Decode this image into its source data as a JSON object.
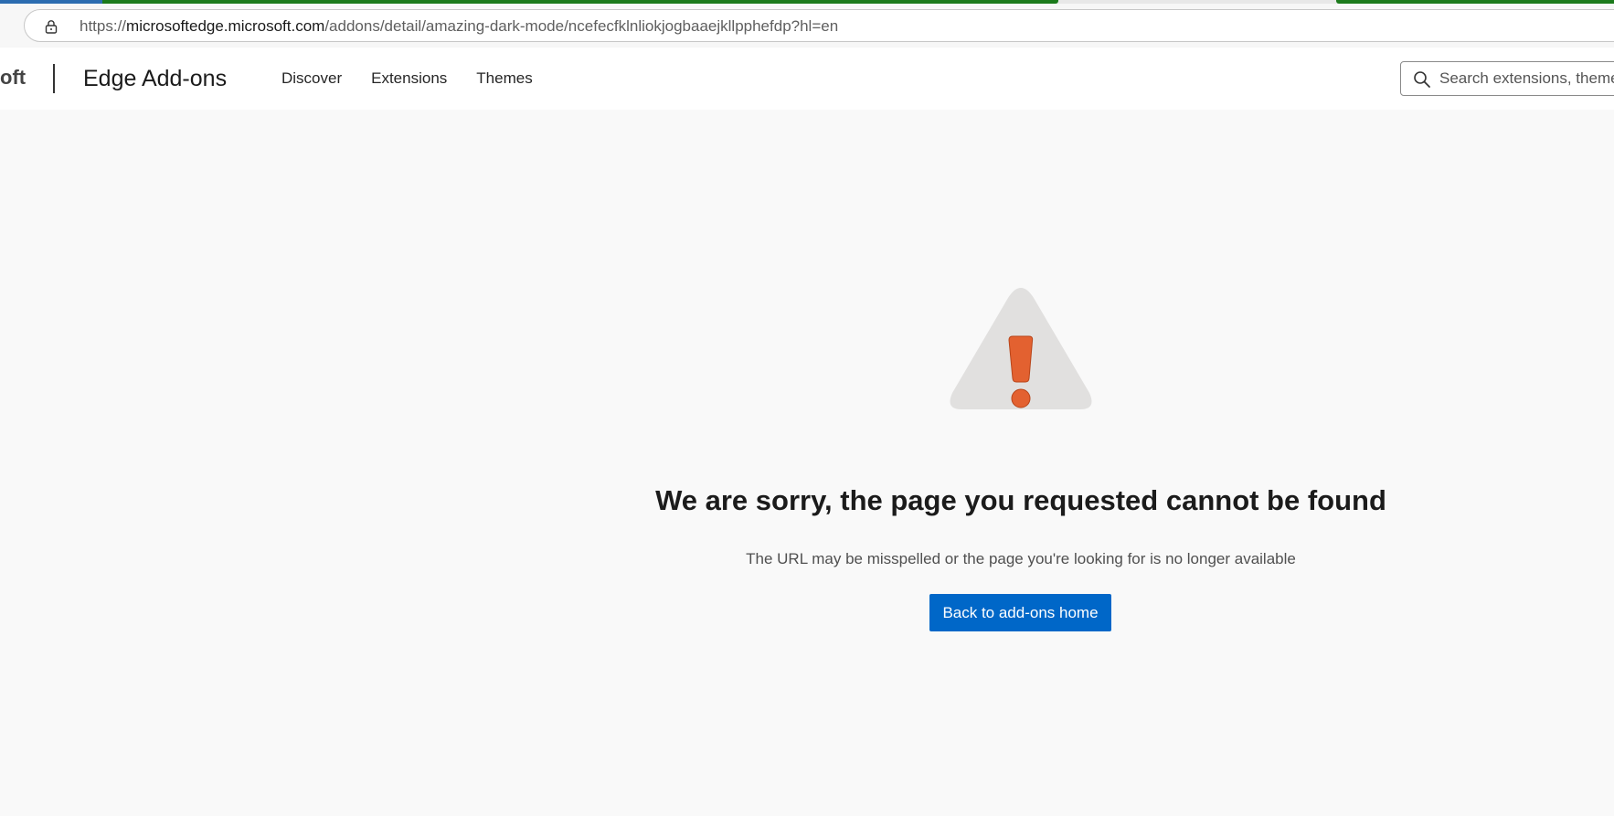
{
  "browser": {
    "url_scheme": "https://",
    "url_host": "microsoftedge.microsoft.com",
    "url_path": "/addons/detail/amazing-dark-mode/ncefecfklnliokjogbaaejkllpphefdp?hl=en"
  },
  "header": {
    "brand_fragment": "oft",
    "product_title": "Edge Add-ons",
    "nav": [
      {
        "label": "Discover"
      },
      {
        "label": "Extensions"
      },
      {
        "label": "Themes"
      }
    ],
    "search": {
      "placeholder": "Search extensions, themes"
    }
  },
  "error": {
    "title": "We are sorry, the page you requested cannot be found",
    "subtitle": "The URL may be misspelled or the page you're looking for is no longer available",
    "button_label": "Back to add-ons home"
  },
  "icons": {
    "lock": "lock-icon",
    "search": "search-icon",
    "warning": "warning-triangle-icon"
  },
  "colors": {
    "accent": "#0067c8",
    "warning_fill": "#e36130",
    "warning_triangle": "#e1e0df"
  }
}
